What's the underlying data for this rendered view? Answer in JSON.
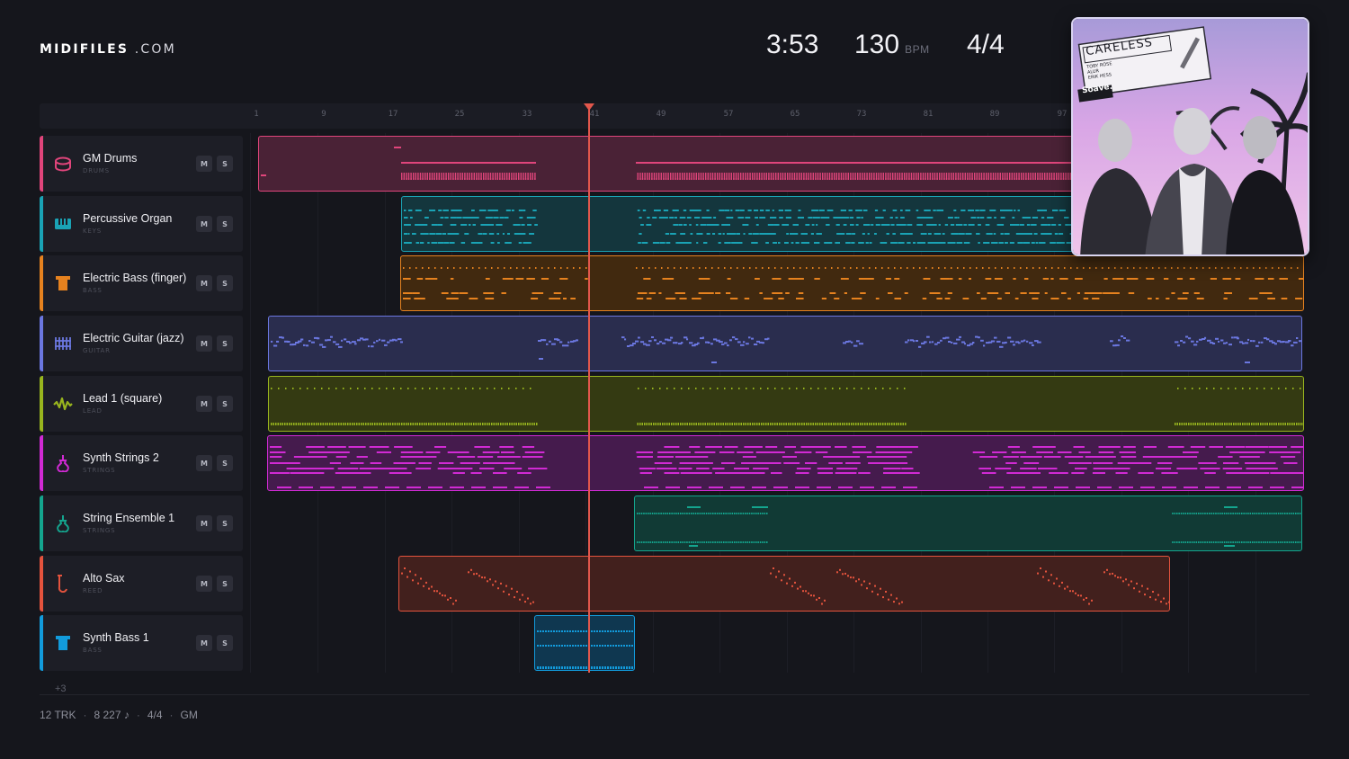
{
  "app": {
    "logo_bold": "MIDIFILES",
    "logo_tld": ".COM"
  },
  "header": {
    "duration": "3:53",
    "bpm": "130",
    "bpm_unit": "BPM",
    "time_signature": "4/4"
  },
  "ruler": {
    "markers": [
      "1",
      "9",
      "17",
      "25",
      "33",
      "41",
      "49",
      "57",
      "65",
      "73",
      "81",
      "89",
      "97"
    ]
  },
  "tracks": [
    {
      "name": "GM Drums",
      "category": "DRUMS",
      "color": "#e0457b",
      "icon": "drum-icon",
      "mute": "M",
      "solo": "S"
    },
    {
      "name": "Percussive Organ",
      "category": "KEYS",
      "color": "#1aa3b5",
      "icon": "keyboard-icon",
      "mute": "M",
      "solo": "S"
    },
    {
      "name": "Electric Bass (finger)",
      "category": "BASS",
      "color": "#e6821f",
      "icon": "bass-amp-icon",
      "mute": "M",
      "solo": "S"
    },
    {
      "name": "Electric Guitar (jazz)",
      "category": "GUITAR",
      "color": "#6b77e0",
      "icon": "guitar-fretboard-icon",
      "mute": "M",
      "solo": "S"
    },
    {
      "name": "Lead 1 (square)",
      "category": "LEAD",
      "color": "#98b51e",
      "icon": "waveform-icon",
      "mute": "M",
      "solo": "S"
    },
    {
      "name": "Synth Strings 2",
      "category": "STRINGS",
      "color": "#d12ad4",
      "icon": "violin-icon",
      "mute": "M",
      "solo": "S"
    },
    {
      "name": "String Ensemble 1",
      "category": "STRINGS",
      "color": "#14a58e",
      "icon": "violin-icon",
      "mute": "M",
      "solo": "S"
    },
    {
      "name": "Alto Sax",
      "category": "REED",
      "color": "#e4533d",
      "icon": "saxophone-icon",
      "mute": "M",
      "solo": "S"
    },
    {
      "name": "Synth Bass 1",
      "category": "BASS",
      "color": "#129bdc",
      "icon": "bass-amp-icon",
      "mute": "M",
      "solo": "S"
    }
  ],
  "more_tracks": "+3",
  "footer": {
    "tracks": "12 TRK",
    "notes": "8 227 ♪",
    "time_signature": "4/4",
    "standard": "GM"
  },
  "cover": {
    "title": "CARELESS",
    "artists": [
      "TOBY ROSE",
      "ALUR",
      "ERIK HESS"
    ],
    "label": "Soave."
  }
}
